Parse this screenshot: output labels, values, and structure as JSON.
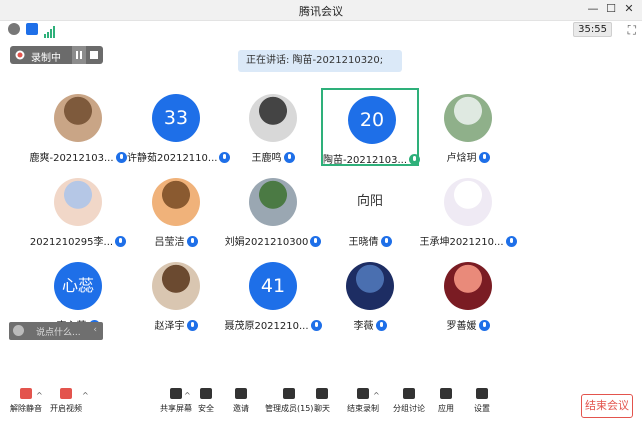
{
  "window": {
    "title": "腾讯会议",
    "minimize": "—",
    "maximize": "☐",
    "close": "✕"
  },
  "status": {
    "timer": "35:55"
  },
  "recording": {
    "label": "录制中"
  },
  "speaking": {
    "text": "正在讲话: 陶苗-2021210320;"
  },
  "participants": [
    {
      "name": "鹿爽-20212103...",
      "avatar": "photo-teddy"
    },
    {
      "name": "许静茹20212110...",
      "avatar": "33"
    },
    {
      "name": "王鹿鸣",
      "avatar": "photo-girl"
    },
    {
      "name": "陶苗-20212103...",
      "avatar": "20"
    },
    {
      "name": "卢焓玥",
      "avatar": "photo-window"
    },
    {
      "name": "2021210295李...",
      "avatar": "photo-baby"
    },
    {
      "name": "吕莹洁",
      "avatar": "photo-dog"
    },
    {
      "name": "刘娟2021210300",
      "avatar": "photo-road"
    },
    {
      "name": "王晓倩",
      "avatar": "photo-text"
    },
    {
      "name": "王承坤2021210...",
      "avatar": "photo-rabbit"
    },
    {
      "name": "齐心蕊",
      "avatar": "心蕊"
    },
    {
      "name": "赵泽宇",
      "avatar": "photo-toy"
    },
    {
      "name": "聂茂原2021210...",
      "avatar": "41"
    },
    {
      "name": "李薇",
      "avatar": "photo-night"
    },
    {
      "name": "罗善媛",
      "avatar": "photo-sunset"
    }
  ],
  "avatar_text": {
    "t8": "向阳"
  },
  "chat": {
    "placeholder": "说点什么..."
  },
  "toolbar": [
    {
      "label": "解除静音",
      "icon": "mic-muted-icon"
    },
    {
      "label": "开启视频",
      "icon": "video-off-icon"
    },
    {
      "label": "共享屏幕",
      "icon": "share-screen-icon"
    },
    {
      "label": "安全",
      "icon": "shield-icon"
    },
    {
      "label": "邀请",
      "icon": "invite-icon"
    },
    {
      "label": "管理成员(15)",
      "icon": "members-icon"
    },
    {
      "label": "聊天",
      "icon": "chat-icon"
    },
    {
      "label": "结束录制",
      "icon": "stop-record-icon"
    },
    {
      "label": "分组讨论",
      "icon": "breakout-icon"
    },
    {
      "label": "应用",
      "icon": "apps-icon"
    },
    {
      "label": "设置",
      "icon": "gear-icon"
    }
  ],
  "end": {
    "label": "结束会议"
  },
  "colors": {
    "accent": "#1e6fe8",
    "active_border": "#2eb07a",
    "end_red": "#e3544d"
  }
}
